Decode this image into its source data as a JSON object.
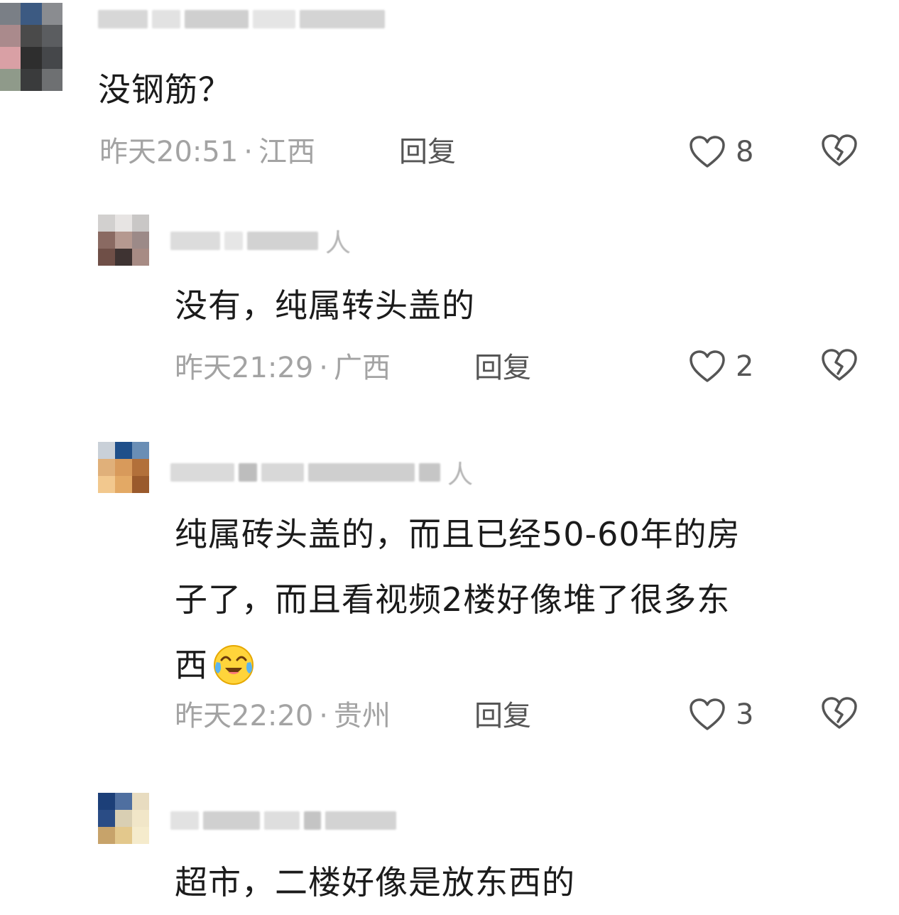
{
  "comments": [
    {
      "level": "top",
      "name_tail": "",
      "text_lines": [
        "没钢筋？"
      ],
      "time": "昨天20:51",
      "location": "江西",
      "reply_label": "回复",
      "likes": "8"
    },
    {
      "level": "reply",
      "name_tail": "人",
      "text_lines": [
        "没有，纯属转头盖的"
      ],
      "time": "昨天21:29",
      "location": "广西",
      "reply_label": "回复",
      "likes": "2"
    },
    {
      "level": "reply",
      "name_tail": "人",
      "text_lines": [
        "纯属砖头盖的，而且已经50-60年的房",
        "子了，而且看视频2楼好像堆了很多东",
        "西"
      ],
      "time": "昨天22:20",
      "location": "贵州",
      "reply_label": "回复",
      "likes": "3"
    },
    {
      "level": "reply",
      "name_tail": "",
      "text_lines": [
        "超市，二楼好像是放东西的"
      ]
    }
  ],
  "separator": "·",
  "colors": {
    "meta": "#a3a3a3",
    "icon": "#555555",
    "text": "#1b1b1b"
  },
  "icons": {
    "like": "heart-outline-icon",
    "dislike": "broken-heart-icon",
    "emoji": "crying-laughing-emoji"
  }
}
